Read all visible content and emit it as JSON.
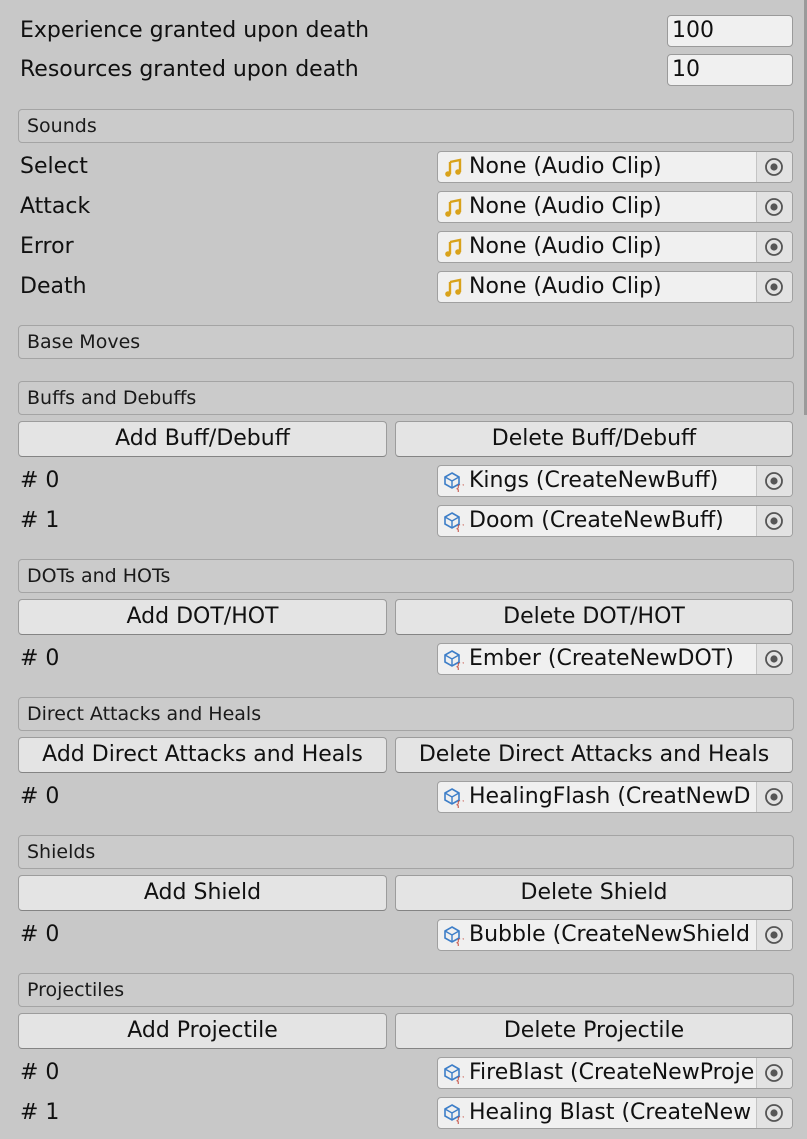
{
  "stats": {
    "experience_label": "Experience granted upon death",
    "experience_value": "100",
    "resources_label": "Resources granted upon death",
    "resources_value": "10"
  },
  "sounds": {
    "header": "Sounds",
    "items": [
      {
        "label": "Select",
        "value": "None (Audio Clip)"
      },
      {
        "label": "Attack",
        "value": "None (Audio Clip)"
      },
      {
        "label": "Error",
        "value": "None (Audio Clip)"
      },
      {
        "label": "Death",
        "value": "None (Audio Clip)"
      }
    ]
  },
  "base_moves": {
    "header": "Base Moves"
  },
  "buffs": {
    "header": "Buffs and Debuffs",
    "add_label": "Add Buff/Debuff",
    "delete_label": "Delete Buff/Debuff",
    "items": [
      {
        "index": "# 0",
        "value": "Kings (CreateNewBuff)"
      },
      {
        "index": "# 1",
        "value": "Doom (CreateNewBuff)"
      }
    ]
  },
  "dots": {
    "header": "DOTs and HOTs",
    "add_label": "Add DOT/HOT",
    "delete_label": "Delete DOT/HOT",
    "items": [
      {
        "index": "# 0",
        "value": "Ember (CreateNewDOT)"
      }
    ]
  },
  "direct": {
    "header": "Direct Attacks and Heals",
    "add_label": "Add Direct Attacks and Heals",
    "delete_label": "Delete Direct Attacks and Heals",
    "items": [
      {
        "index": "# 0",
        "value": "HealingFlash (CreatNewD"
      }
    ]
  },
  "shields": {
    "header": "Shields",
    "add_label": "Add Shield",
    "delete_label": "Delete Shield",
    "items": [
      {
        "index": "# 0",
        "value": "Bubble (CreateNewShield"
      }
    ]
  },
  "projectiles": {
    "header": "Projectiles",
    "add_label": "Add Projectile",
    "delete_label": "Delete Projectile",
    "items": [
      {
        "index": "# 0",
        "value": "FireBlast (CreateNewProje"
      },
      {
        "index": "# 1",
        "value": "Healing Blast (CreateNew"
      }
    ]
  },
  "icons": {
    "audio": "audio-clip-icon",
    "script": "scriptable-object-icon",
    "picker": "object-picker-icon"
  },
  "colors": {
    "background": "#c8c8c8",
    "audio_icon": "#d9a21a",
    "script_cube": "#3d7ec8",
    "script_braces": "#c0392b"
  }
}
